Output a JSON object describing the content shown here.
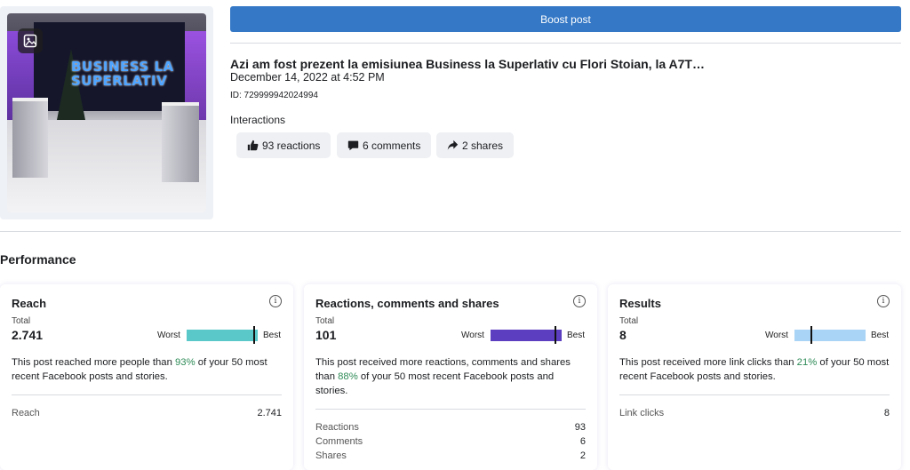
{
  "post": {
    "thumbnail_text": "BUSINESS LA SUPERLATIV",
    "boost_label": "Boost post",
    "title": "Azi am fost prezent la emisiunea Business la Superlativ cu Flori Stoian, la A7T…",
    "date": "December 14, 2022 at 4:52 PM",
    "id_text": "ID: 729999942024994",
    "interactions_label": "Interactions",
    "chips": {
      "reactions": "93 reactions",
      "comments": "6 comments",
      "shares": "2 shares"
    }
  },
  "performance": {
    "title": "Performance",
    "cards": {
      "reach": {
        "title": "Reach",
        "total_label": "Total",
        "total": "2.741",
        "worst": "Worst",
        "best": "Best",
        "bar_color": "#5ac8c8",
        "level": 0.93,
        "desc_pre": "This post reached more people than ",
        "desc_pct": "93%",
        "desc_post": " of your 50 most recent Facebook posts and stories.",
        "metrics": [
          {
            "label": "Reach",
            "value": "2.741"
          }
        ]
      },
      "engagement": {
        "title": "Reactions, comments and shares",
        "total_label": "Total",
        "total": "101",
        "worst": "Worst",
        "best": "Best",
        "bar_color": "#5b3fc0",
        "level": 0.88,
        "desc_pre": "This post received more reactions, comments and shares than ",
        "desc_pct": "88%",
        "desc_post": " of your 50 most recent Facebook posts and stories.",
        "metrics": [
          {
            "label": "Reactions",
            "value": "93"
          },
          {
            "label": "Comments",
            "value": "6"
          },
          {
            "label": "Shares",
            "value": "2"
          }
        ]
      },
      "results": {
        "title": "Results",
        "total_label": "Total",
        "total": "8",
        "worst": "Worst",
        "best": "Best",
        "bar_color": "#a9d4f5",
        "level": 0.21,
        "desc_pre": "This post received more link clicks than ",
        "desc_pct": "21%",
        "desc_post": " of your 50 most recent Facebook posts and stories.",
        "metrics": [
          {
            "label": "Link clicks",
            "value": "8"
          }
        ]
      }
    }
  },
  "icons": {
    "photo": "photo-icon",
    "like": "thumbs-up-icon",
    "comment": "comment-icon",
    "share": "share-arrow-icon",
    "info": "info-icon"
  }
}
